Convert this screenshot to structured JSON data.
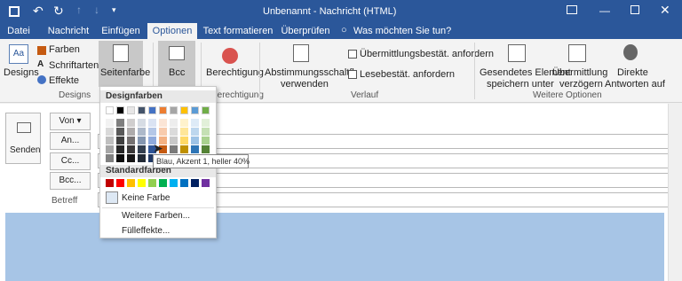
{
  "window": {
    "title": "Unbenannt - Nachricht (HTML)",
    "accent": "#2b579a"
  },
  "tabs": [
    {
      "label": "Datei"
    },
    {
      "label": "Nachricht"
    },
    {
      "label": "Einfügen"
    },
    {
      "label": "Optionen"
    },
    {
      "label": "Text formatieren"
    },
    {
      "label": "Überprüfen"
    }
  ],
  "tell_me": "Was möchten Sie tun?",
  "ribbon": {
    "designs": {
      "label": "Designs",
      "group": "Designs"
    },
    "farben": "Farben",
    "schriftarten": "Schriftarten",
    "effekte": "Effekte",
    "seitenfarbe": "Seitenfarbe",
    "bcc": "Bcc",
    "berechtigung": "Berechtigung",
    "berechtigung_group": "Berechtigung",
    "abstimmung_1": "Abstimmungsschaltfl.",
    "abstimmung_2": "verwenden",
    "uebermittlung_check": "Übermittlungsbestät. anfordern",
    "lese_check": "Lesebestät. anfordern",
    "verlauf_group": "Verlauf",
    "gesendet_1": "Gesendetes Element",
    "gesendet_2": "speichern unter",
    "verzoegern_1": "Übermittlung",
    "verzoegern_2": "verzögern",
    "direkte_1": "Direkte",
    "direkte_2": "Antworten auf",
    "weitere_group": "Weitere Optionen"
  },
  "compose": {
    "send": "Senden",
    "von": "Von",
    "an": "An...",
    "cc": "Cc...",
    "bcc": "Bcc...",
    "betreff": "Betreff",
    "body_color": "#a7c5e6"
  },
  "popup": {
    "design_header": "Designfarben",
    "standard_header": "Standardfarben",
    "keine_farbe": "Keine Farbe",
    "weitere_farben": "Weitere Farben...",
    "fuelleffekte": "Fülleffekte...",
    "theme_top": [
      "#ffffff",
      "#000000",
      "#e7e6e6",
      "#44546a",
      "#4472c4",
      "#ed7d31",
      "#a5a5a5",
      "#ffc000",
      "#5b9bd5",
      "#70ad47"
    ],
    "theme_columns": [
      [
        "#f2f2f2",
        "#d9d9d9",
        "#bfbfbf",
        "#a6a6a6",
        "#808080"
      ],
      [
        "#7f7f7f",
        "#595959",
        "#404040",
        "#262626",
        "#0d0d0d"
      ],
      [
        "#d0cece",
        "#aeabab",
        "#757171",
        "#3a3838",
        "#171616"
      ],
      [
        "#d6dce4",
        "#adb9ca",
        "#8496b0",
        "#333f4f",
        "#222a35"
      ],
      [
        "#dae3f3",
        "#b4c7e7",
        "#8faadc",
        "#2f5597",
        "#203864"
      ],
      [
        "#fbe5d6",
        "#f8cbad",
        "#f4b183",
        "#c55a11",
        "#843c0c"
      ],
      [
        "#ededed",
        "#dbdbdb",
        "#c9c9c9",
        "#7b7b7b",
        "#525252"
      ],
      [
        "#fff2cc",
        "#ffe699",
        "#ffd966",
        "#bf9000",
        "#7f6000"
      ],
      [
        "#deebf7",
        "#bdd7ee",
        "#9dc3e6",
        "#2e75b6",
        "#1f4e79"
      ],
      [
        "#e2f0d9",
        "#c5e0b4",
        "#a9d18e",
        "#548235",
        "#385723"
      ]
    ],
    "standard": [
      "#c00000",
      "#ff0000",
      "#ffc000",
      "#ffff00",
      "#92d050",
      "#00b050",
      "#00b0f0",
      "#0070c0",
      "#002060",
      "#7030a0"
    ]
  },
  "tooltip": "Blau, Akzent 1, heller 40%"
}
